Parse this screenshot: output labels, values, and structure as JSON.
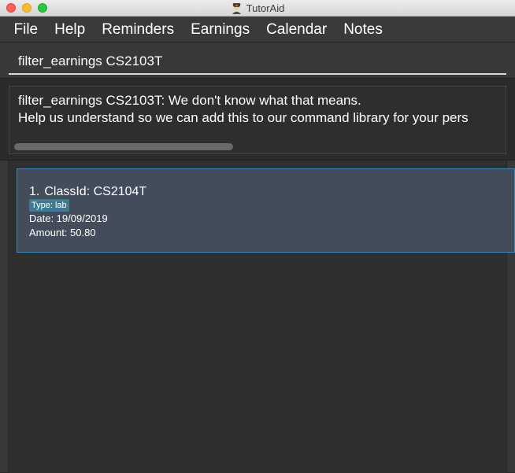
{
  "window": {
    "title": "TutorAid"
  },
  "menu": {
    "items": [
      "File",
      "Help",
      "Reminders",
      "Earnings",
      "Calendar",
      "Notes"
    ]
  },
  "command": {
    "value": "filter_earnings CS2103T",
    "placeholder": ""
  },
  "result": {
    "lines": [
      "filter_earnings CS2103T: We don't know what that means.",
      "Help us understand so we can add this to our command library for your pers"
    ]
  },
  "earnings": [
    {
      "index": "1.",
      "class_label": "ClassId: CS2104T",
      "type": "Type: lab",
      "date": "Date: 19/09/2019",
      "amount": "Amount: 50.80"
    }
  ],
  "colors": {
    "background": "#2b2b2b",
    "card": "#424c5a",
    "card_border": "#3c88b5",
    "tag": "#3e7b91"
  },
  "icons": {
    "app": "tutoraid-icon"
  }
}
